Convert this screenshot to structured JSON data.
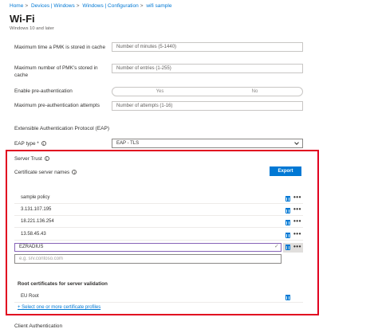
{
  "breadcrumb": [
    "Home",
    "Devices | Windows",
    "Windows | Configuration",
    "wifi sample"
  ],
  "header": {
    "title": "Wi-Fi",
    "subtitle": "Windows 10 and later"
  },
  "fields": {
    "pmk_time": {
      "label": "Maximum time a PMK is stored in cache",
      "placeholder": "Number of minutes (5-1440)"
    },
    "pmk_count": {
      "label": "Maximum number of PMK's stored in cache",
      "placeholder": "Number of entries (1-255)"
    },
    "pre_auth": {
      "label": "Enable pre-authentication",
      "options": [
        "Yes",
        "No"
      ]
    },
    "pre_auth_attempts": {
      "label": "Maximum pre-authentication attempts",
      "placeholder": "Number of attempts (1-16)"
    }
  },
  "eap": {
    "section_title": "Extensible Authentication Protocol (EAP)",
    "type_label": "EAP type *",
    "type_value": "EAP - TLS"
  },
  "server_trust": {
    "title": "Server Trust",
    "cert_names_label": "Certificate server names",
    "export_label": "Export",
    "server_names": [
      "sample policy",
      "3.131.107.195",
      "18.221.136.254",
      "13.58.45.43"
    ],
    "editing_value": "EZRADIUS",
    "new_placeholder": "e.g. srv.contoso.com",
    "more_glyph": "•••",
    "check_glyph": "✓"
  },
  "root_certs": {
    "title": "Root certificates for server validation",
    "items": [
      "EU Root"
    ],
    "add_link": "+ Select one or more certificate profiles"
  },
  "client_auth": {
    "title": "Client Authentication"
  },
  "colors": {
    "accent": "#0078d4",
    "highlight_border": "#e1001f"
  }
}
